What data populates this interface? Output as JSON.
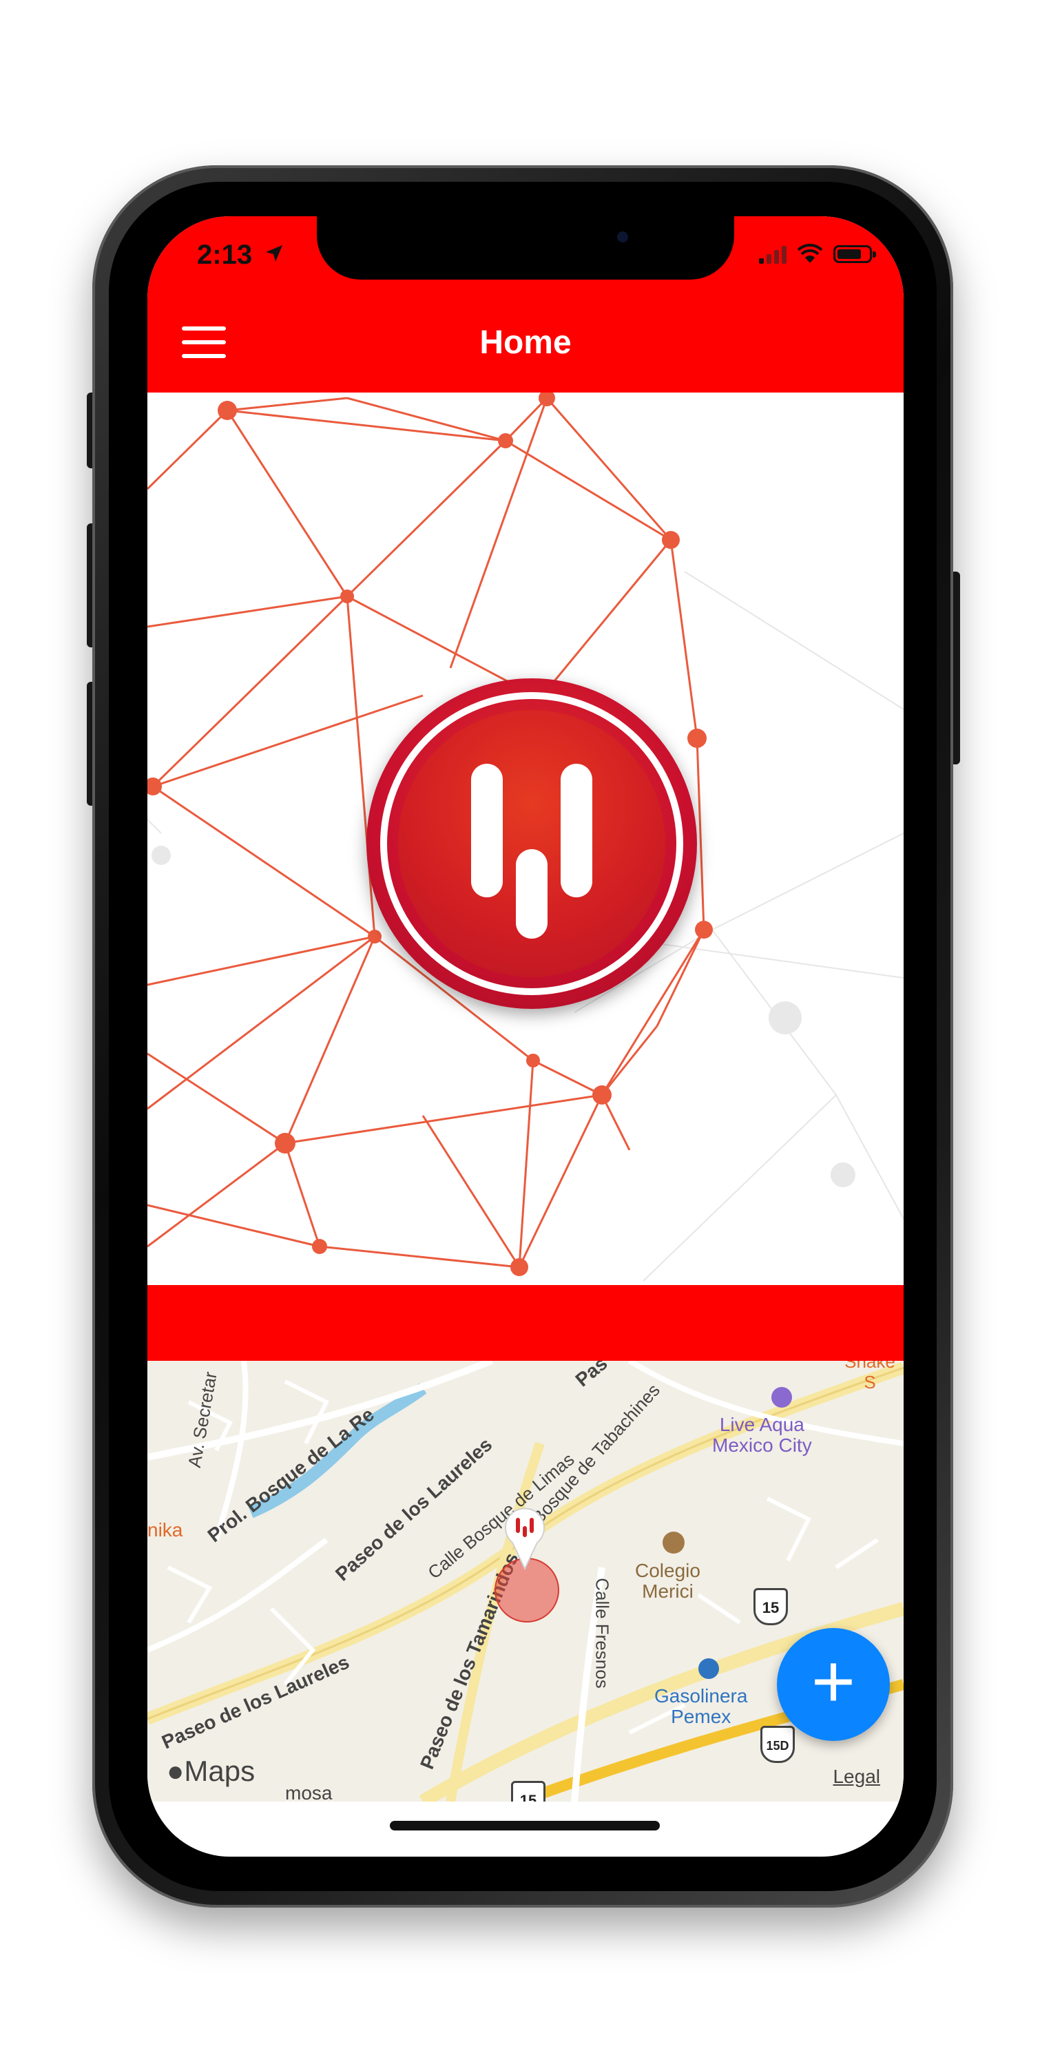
{
  "status_bar": {
    "time": "2:13",
    "location_icon": "location-arrow-icon",
    "signal_icon": "cellular-signal-icon",
    "wifi_icon": "wifi-icon",
    "battery_icon": "battery-icon"
  },
  "header": {
    "title": "Home",
    "menu_icon": "hamburger-menu-icon",
    "background_color": "#fe0000"
  },
  "hero": {
    "logo_icon": "app-logo-icon",
    "accent_color": "#c8102e"
  },
  "map": {
    "streets": [
      "Av. Secretar",
      "Prol. Bosque de La Re",
      "Paseo de los Laureles",
      "Calle Bosque de Limas",
      "Bosque de Tabachines",
      "Paseo de los Tamarindos",
      "Calle Fresnos",
      "Paseo de los Laureles",
      "Pas",
      "nika",
      "mosa"
    ],
    "pois": [
      {
        "name": "Live Aqua\nMexico City",
        "color": "#7b5cc4"
      },
      {
        "name": "Colegio\nMerici",
        "color": "#8a6a3e"
      },
      {
        "name": "Gasolinera\nPemex",
        "color": "#2f74c0"
      },
      {
        "name": "Shake S",
        "color": "#e06a2a"
      }
    ],
    "shields": [
      "15",
      "15D",
      "15"
    ],
    "attribution": "Maps",
    "legal_label": "Legal"
  },
  "fab": {
    "label": "+",
    "icon": "add-icon",
    "color": "#0a84ff"
  }
}
